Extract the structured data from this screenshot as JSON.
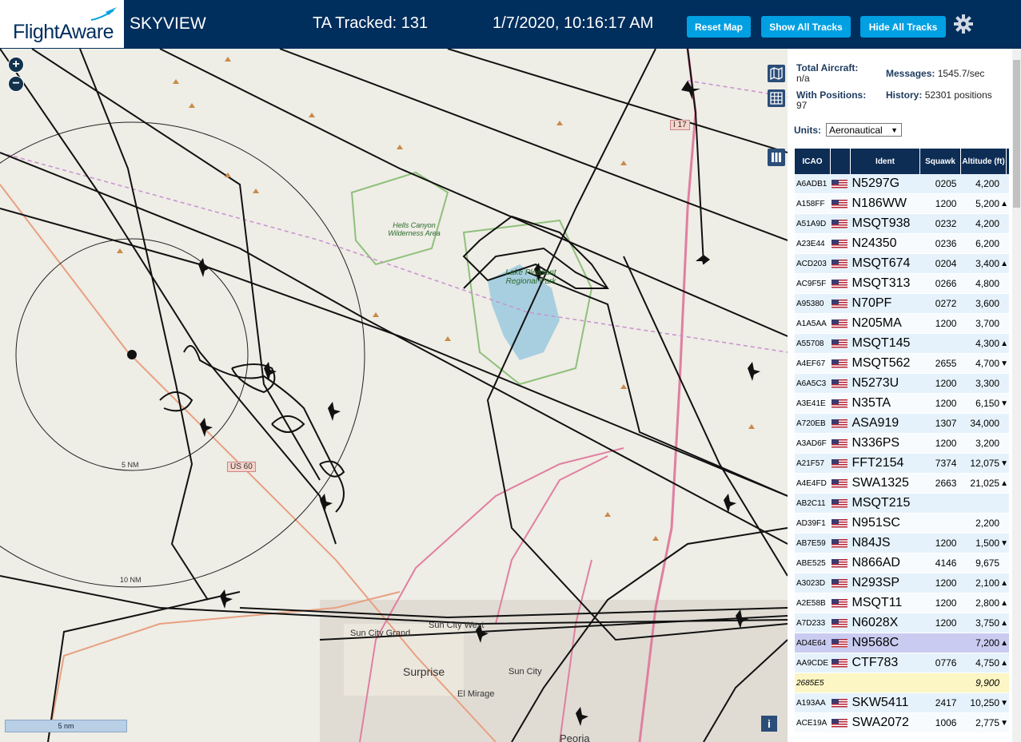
{
  "header": {
    "logo_text": "FlightAware",
    "app_title": "SKYVIEW",
    "tracked": "TA Tracked: 131",
    "datetime": "1/7/2020, 10:16:17 AM",
    "buttons": {
      "reset": "Reset Map",
      "show": "Show All Tracks",
      "hide": "Hide All Tracks"
    }
  },
  "map": {
    "scale_label": "5 nm",
    "ring_labels": [
      "5 NM",
      "10 NM"
    ],
    "places": [
      "Hells Canyon Wilderness Area",
      "Lake Pleasant Regional Park",
      "Sun City Grand",
      "Sun City West",
      "Surprise",
      "Sun City",
      "El Mirage",
      "Peoria",
      "US 60",
      "I 17"
    ],
    "info": "i"
  },
  "stats": {
    "total_label": "Total Aircraft:",
    "total_value": "n/a",
    "messages_label": "Messages:",
    "messages_value": "1545.7/sec",
    "positions_label": "With Positions:",
    "positions_value": "97",
    "history_label": "History:",
    "history_value": "52301 positions",
    "units_label": "Units:",
    "units_value": "Aeronautical"
  },
  "table": {
    "headers": [
      "ICAO",
      "",
      "Ident",
      "Squawk",
      "Altitude (ft)"
    ],
    "rows": [
      {
        "icao": "A6ADB1",
        "flag": true,
        "ident": "N5297G",
        "squawk": "0205",
        "alt": "4,200",
        "trend": ""
      },
      {
        "icao": "A158FF",
        "flag": true,
        "ident": "N186WW",
        "squawk": "1200",
        "alt": "5,200",
        "trend": "▲"
      },
      {
        "icao": "A51A9D",
        "flag": true,
        "ident": "MSQT938",
        "squawk": "0232",
        "alt": "4,200",
        "trend": ""
      },
      {
        "icao": "A23E44",
        "flag": true,
        "ident": "N24350",
        "squawk": "0236",
        "alt": "6,200",
        "trend": ""
      },
      {
        "icao": "ACD203",
        "flag": true,
        "ident": "MSQT674",
        "squawk": "0204",
        "alt": "3,400",
        "trend": "▲"
      },
      {
        "icao": "AC9F5F",
        "flag": true,
        "ident": "MSQT313",
        "squawk": "0266",
        "alt": "4,800",
        "trend": ""
      },
      {
        "icao": "A95380",
        "flag": true,
        "ident": "N70PF",
        "squawk": "0272",
        "alt": "3,600",
        "trend": ""
      },
      {
        "icao": "A1A5AA",
        "flag": true,
        "ident": "N205MA",
        "squawk": "1200",
        "alt": "3,700",
        "trend": ""
      },
      {
        "icao": "A55708",
        "flag": true,
        "ident": "MSQT145",
        "squawk": "",
        "alt": "4,300",
        "trend": "▲"
      },
      {
        "icao": "A4EF67",
        "flag": true,
        "ident": "MSQT562",
        "squawk": "2655",
        "alt": "4,700",
        "trend": "▼"
      },
      {
        "icao": "A6A5C3",
        "flag": true,
        "ident": "N5273U",
        "squawk": "1200",
        "alt": "3,300",
        "trend": ""
      },
      {
        "icao": "A3E41E",
        "flag": true,
        "ident": "N35TA",
        "squawk": "1200",
        "alt": "6,150",
        "trend": "▼"
      },
      {
        "icao": "A720EB",
        "flag": true,
        "ident": "ASA919",
        "squawk": "1307",
        "alt": "34,000",
        "trend": ""
      },
      {
        "icao": "A3AD6F",
        "flag": true,
        "ident": "N336PS",
        "squawk": "1200",
        "alt": "3,200",
        "trend": ""
      },
      {
        "icao": "A21F57",
        "flag": true,
        "ident": "FFT2154",
        "squawk": "7374",
        "alt": "12,075",
        "trend": "▼"
      },
      {
        "icao": "A4E4FD",
        "flag": true,
        "ident": "SWA1325",
        "squawk": "2663",
        "alt": "21,025",
        "trend": "▲"
      },
      {
        "icao": "AB2C11",
        "flag": true,
        "ident": "MSQT215",
        "squawk": "",
        "alt": "",
        "trend": ""
      },
      {
        "icao": "AD39F1",
        "flag": true,
        "ident": "N951SC",
        "squawk": "",
        "alt": "2,200",
        "trend": ""
      },
      {
        "icao": "AB7E59",
        "flag": true,
        "ident": "N84JS",
        "squawk": "1200",
        "alt": "1,500",
        "trend": "▼"
      },
      {
        "icao": "ABE525",
        "flag": true,
        "ident": "N866AD",
        "squawk": "4146",
        "alt": "9,675",
        "trend": ""
      },
      {
        "icao": "A3023D",
        "flag": true,
        "ident": "N293SP",
        "squawk": "1200",
        "alt": "2,100",
        "trend": "▲"
      },
      {
        "icao": "A2E58B",
        "flag": true,
        "ident": "MSQT11",
        "squawk": "1200",
        "alt": "2,800",
        "trend": "▲"
      },
      {
        "icao": "A7D233",
        "flag": true,
        "ident": "N6028X",
        "squawk": "1200",
        "alt": "3,750",
        "trend": "▲"
      },
      {
        "icao": "AD4E64",
        "flag": true,
        "ident": "N9568C",
        "squawk": "",
        "alt": "7,200",
        "trend": "▲",
        "selected": true
      },
      {
        "icao": "AA9CDE",
        "flag": true,
        "ident": "CTF783",
        "squawk": "0776",
        "alt": "4,750",
        "trend": "▲"
      },
      {
        "icao": "2685E5",
        "flag": false,
        "ident": "",
        "squawk": "",
        "alt": "9,900",
        "trend": "",
        "noloc": true
      },
      {
        "icao": "A193AA",
        "flag": true,
        "ident": "SKW5411",
        "squawk": "2417",
        "alt": "10,250",
        "trend": "▼"
      },
      {
        "icao": "ACE19A",
        "flag": true,
        "ident": "SWA2072",
        "squawk": "1006",
        "alt": "2,775",
        "trend": "▼"
      }
    ]
  }
}
